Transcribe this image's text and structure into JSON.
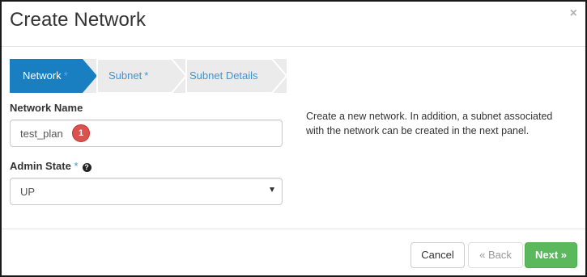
{
  "dialog": {
    "title": "Create Network",
    "close_glyph": "×"
  },
  "wizard": {
    "steps": [
      {
        "label": "Network",
        "required_mark": "*",
        "active": true
      },
      {
        "label": "Subnet",
        "required_mark": "*",
        "active": false
      },
      {
        "label": "Subnet Details",
        "required_mark": "",
        "active": false
      }
    ],
    "colors": {
      "active": "#1a7fc1",
      "inactive": "#ebebeb",
      "separator": "#ffffff"
    }
  },
  "form": {
    "network_name": {
      "label": "Network Name",
      "value": "test_plan",
      "annotation_badge": "1"
    },
    "admin_state": {
      "label": "Admin State",
      "required_mark": "*",
      "help_icon": "question-circle-icon",
      "help_glyph": "?",
      "selected": "UP"
    }
  },
  "help": {
    "text": "Create a new network. In addition, a subnet associated with the network can be created in the next panel."
  },
  "footer": {
    "cancel_label": "Cancel",
    "back_label": "« Back",
    "next_label": "Next »"
  }
}
